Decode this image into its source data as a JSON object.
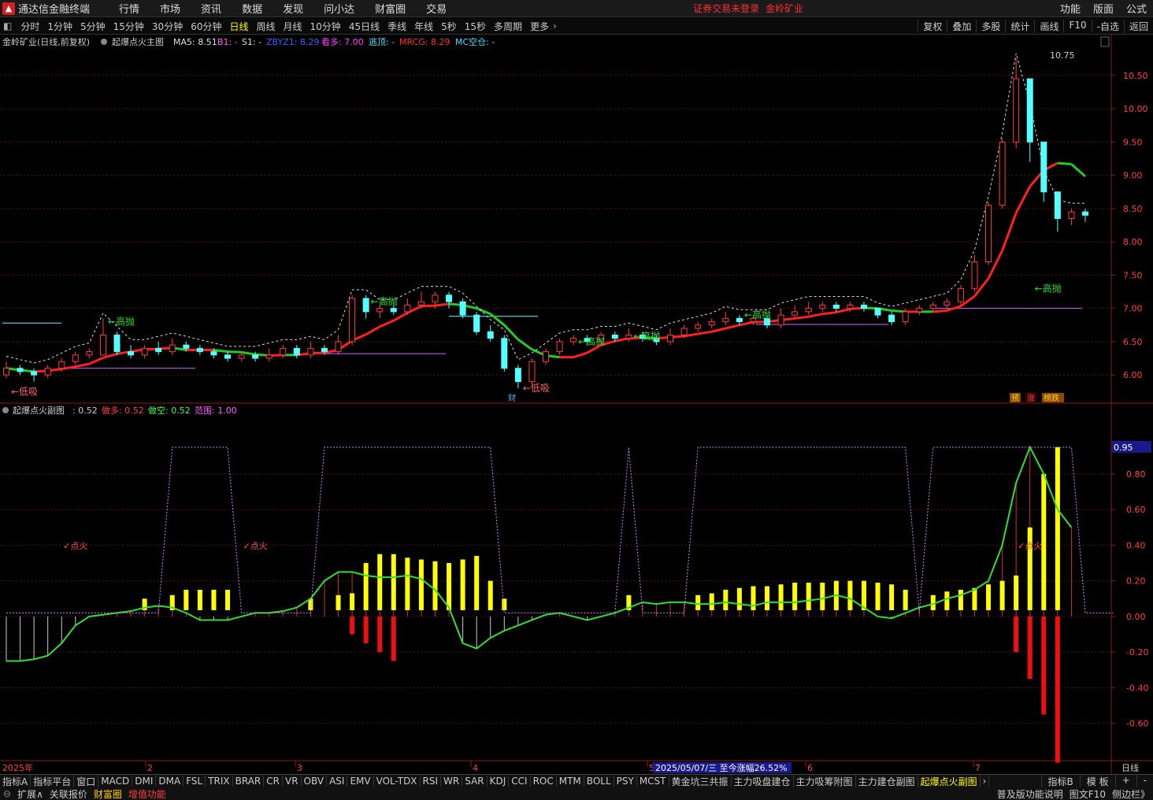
{
  "app": {
    "name": "通达信金融终端",
    "warning": "证券交易未登录",
    "stock": "金岭矿业"
  },
  "menu": [
    "行情",
    "市场",
    "资讯",
    "数据",
    "发现",
    "问小达",
    "财富圈",
    "交易"
  ],
  "menu_right": [
    "功能",
    "版面",
    "公式"
  ],
  "periods": [
    "分时",
    "1分钟",
    "5分钟",
    "15分钟",
    "30分钟",
    "60分钟",
    "日线",
    "周线",
    "月线",
    "10分钟",
    "45日线",
    "季线",
    "年线",
    "5秒",
    "15秒",
    "多周期",
    "更多"
  ],
  "active_period": "日线",
  "tools": [
    "复权",
    "叠加",
    "多股",
    "统计",
    "画线",
    "F10",
    "-自选",
    "返回"
  ],
  "main_info": {
    "title": "金岭矿业(日线,前复权)",
    "indicator": "起爆点火主图",
    "ma5": "MA5: 8.51",
    "b1": "B1: -",
    "s1": "S1: -",
    "zbyz": "ZBYZ1: 8.29",
    "kanduo": "看多: 7.00",
    "taoding": "逃顶: -",
    "mrcg": "MRCG: 8.29",
    "mckong": "MC空仓: -"
  },
  "sub_info": {
    "name": "起爆点火副图",
    "v1": ": 0.52",
    "zuoduo": "做多: 0.52",
    "zuokong": "做空: 0.52",
    "fanwei": "范围: 1.00"
  },
  "colors": {
    "bg": "#000000",
    "up": "#ff3c3c",
    "down": "#54ffff",
    "green": "#33cc33",
    "yellow": "#ffff00",
    "magenta": "#cc66ff"
  },
  "chart_data": [
    {
      "type": "candlestick",
      "title": "金岭矿业(日线,前复权)",
      "y_ticks": [
        10.5,
        10.0,
        9.5,
        9.0,
        8.5,
        8.0,
        7.5,
        7.0,
        6.5,
        6.0
      ],
      "ylim": [
        5.6,
        10.9
      ],
      "annotations": [
        {
          "text": "高抛",
          "at": 7,
          "price": 6.8
        },
        {
          "text": "高抛",
          "at": 26,
          "price": 7.1
        },
        {
          "text": "高抛",
          "at": 41,
          "price": 6.5
        },
        {
          "text": "高抛",
          "at": 45,
          "price": 6.58
        },
        {
          "text": "高抛",
          "at": 53,
          "price": 6.9
        },
        {
          "text": "高抛",
          "at": 74,
          "price": 7.3
        },
        {
          "text": "低吸",
          "at": 37,
          "price": 5.8
        },
        {
          "text": "低吸",
          "at": 0,
          "price": 5.75
        }
      ],
      "high_label": "10.75",
      "bottom_tags": [
        "财"
      ],
      "badges": [
        "预",
        "涨",
        "榜跌"
      ],
      "candles": [
        {
          "o": 6.0,
          "c": 6.1,
          "h": 6.2,
          "l": 5.95
        },
        {
          "o": 6.1,
          "c": 6.05,
          "h": 6.15,
          "l": 6.0
        },
        {
          "o": 6.05,
          "c": 6.0,
          "h": 6.1,
          "l": 5.9
        },
        {
          "o": 6.0,
          "c": 6.1,
          "h": 6.15,
          "l": 5.95
        },
        {
          "o": 6.1,
          "c": 6.2,
          "h": 6.25,
          "l": 6.05
        },
        {
          "o": 6.2,
          "c": 6.3,
          "h": 6.35,
          "l": 6.15
        },
        {
          "o": 6.3,
          "c": 6.35,
          "h": 6.4,
          "l": 6.25
        },
        {
          "o": 6.3,
          "c": 6.6,
          "h": 6.85,
          "l": 6.3
        },
        {
          "o": 6.6,
          "c": 6.35,
          "h": 6.65,
          "l": 6.3
        },
        {
          "o": 6.35,
          "c": 6.3,
          "h": 6.45,
          "l": 6.25
        },
        {
          "o": 6.3,
          "c": 6.4,
          "h": 6.45,
          "l": 6.25
        },
        {
          "o": 6.4,
          "c": 6.35,
          "h": 6.5,
          "l": 6.3
        },
        {
          "o": 6.35,
          "c": 6.45,
          "h": 6.55,
          "l": 6.3
        },
        {
          "o": 6.45,
          "c": 6.4,
          "h": 6.5,
          "l": 6.35
        },
        {
          "o": 6.4,
          "c": 6.35,
          "h": 6.45,
          "l": 6.3
        },
        {
          "o": 6.35,
          "c": 6.3,
          "h": 6.4,
          "l": 6.25
        },
        {
          "o": 6.3,
          "c": 6.25,
          "h": 6.35,
          "l": 6.2
        },
        {
          "o": 6.25,
          "c": 6.3,
          "h": 6.35,
          "l": 6.2
        },
        {
          "o": 6.3,
          "c": 6.25,
          "h": 6.35,
          "l": 6.2
        },
        {
          "o": 6.25,
          "c": 6.3,
          "h": 6.4,
          "l": 6.2
        },
        {
          "o": 6.3,
          "c": 6.4,
          "h": 6.45,
          "l": 6.25
        },
        {
          "o": 6.4,
          "c": 6.3,
          "h": 6.45,
          "l": 6.25
        },
        {
          "o": 6.3,
          "c": 6.4,
          "h": 6.5,
          "l": 6.25
        },
        {
          "o": 6.4,
          "c": 6.35,
          "h": 6.45,
          "l": 6.3
        },
        {
          "o": 6.35,
          "c": 6.5,
          "h": 6.6,
          "l": 6.3
        },
        {
          "o": 6.5,
          "c": 7.15,
          "h": 7.2,
          "l": 6.45
        },
        {
          "o": 7.15,
          "c": 6.95,
          "h": 7.2,
          "l": 6.85
        },
        {
          "o": 6.95,
          "c": 7.0,
          "h": 7.05,
          "l": 6.85
        },
        {
          "o": 7.0,
          "c": 6.95,
          "h": 7.05,
          "l": 6.9
        },
        {
          "o": 6.95,
          "c": 7.05,
          "h": 7.15,
          "l": 6.9
        },
        {
          "o": 7.05,
          "c": 7.1,
          "h": 7.25,
          "l": 7.0
        },
        {
          "o": 7.1,
          "c": 7.2,
          "h": 7.25,
          "l": 7.0
        },
        {
          "o": 7.2,
          "c": 7.1,
          "h": 7.25,
          "l": 7.0
        },
        {
          "o": 7.1,
          "c": 6.9,
          "h": 7.15,
          "l": 6.85
        },
        {
          "o": 6.9,
          "c": 6.65,
          "h": 6.95,
          "l": 6.6
        },
        {
          "o": 6.65,
          "c": 6.55,
          "h": 6.75,
          "l": 6.5
        },
        {
          "o": 6.55,
          "c": 6.1,
          "h": 6.6,
          "l": 6.05
        },
        {
          "o": 6.1,
          "c": 5.9,
          "h": 6.15,
          "l": 5.8
        },
        {
          "o": 5.9,
          "c": 6.2,
          "h": 6.25,
          "l": 5.85
        },
        {
          "o": 6.2,
          "c": 6.35,
          "h": 6.4,
          "l": 6.15
        },
        {
          "o": 6.35,
          "c": 6.5,
          "h": 6.55,
          "l": 6.3
        },
        {
          "o": 6.5,
          "c": 6.55,
          "h": 6.6,
          "l": 6.45
        },
        {
          "o": 6.55,
          "c": 6.5,
          "h": 6.6,
          "l": 6.45
        },
        {
          "o": 6.5,
          "c": 6.6,
          "h": 6.65,
          "l": 6.45
        },
        {
          "o": 6.6,
          "c": 6.55,
          "h": 6.65,
          "l": 6.5
        },
        {
          "o": 6.55,
          "c": 6.6,
          "h": 6.7,
          "l": 6.5
        },
        {
          "o": 6.6,
          "c": 6.55,
          "h": 6.65,
          "l": 6.5
        },
        {
          "o": 6.55,
          "c": 6.5,
          "h": 6.6,
          "l": 6.45
        },
        {
          "o": 6.5,
          "c": 6.6,
          "h": 6.7,
          "l": 6.45
        },
        {
          "o": 6.6,
          "c": 6.7,
          "h": 6.75,
          "l": 6.55
        },
        {
          "o": 6.7,
          "c": 6.75,
          "h": 6.8,
          "l": 6.65
        },
        {
          "o": 6.75,
          "c": 6.8,
          "h": 6.85,
          "l": 6.7
        },
        {
          "o": 6.8,
          "c": 6.85,
          "h": 6.95,
          "l": 6.75
        },
        {
          "o": 6.85,
          "c": 6.8,
          "h": 6.9,
          "l": 6.75
        },
        {
          "o": 6.8,
          "c": 6.85,
          "h": 6.9,
          "l": 6.75
        },
        {
          "o": 6.85,
          "c": 6.75,
          "h": 6.9,
          "l": 6.7
        },
        {
          "o": 6.75,
          "c": 6.9,
          "h": 7.0,
          "l": 6.7
        },
        {
          "o": 6.9,
          "c": 6.95,
          "h": 7.05,
          "l": 6.85
        },
        {
          "o": 6.95,
          "c": 7.0,
          "h": 7.1,
          "l": 6.9
        },
        {
          "o": 7.0,
          "c": 7.05,
          "h": 7.1,
          "l": 6.95
        },
        {
          "o": 7.05,
          "c": 7.0,
          "h": 7.1,
          "l": 6.95
        },
        {
          "o": 7.0,
          "c": 7.05,
          "h": 7.1,
          "l": 6.95
        },
        {
          "o": 7.05,
          "c": 7.0,
          "h": 7.1,
          "l": 6.95
        },
        {
          "o": 7.0,
          "c": 6.9,
          "h": 7.0,
          "l": 6.85
        },
        {
          "o": 6.9,
          "c": 6.8,
          "h": 6.95,
          "l": 6.75
        },
        {
          "o": 6.8,
          "c": 6.95,
          "h": 7.0,
          "l": 6.75
        },
        {
          "o": 6.95,
          "c": 7.0,
          "h": 7.05,
          "l": 6.9
        },
        {
          "o": 7.0,
          "c": 7.05,
          "h": 7.1,
          "l": 6.95
        },
        {
          "o": 7.05,
          "c": 7.1,
          "h": 7.15,
          "l": 7.0
        },
        {
          "o": 7.1,
          "c": 7.3,
          "h": 7.35,
          "l": 7.05
        },
        {
          "o": 7.3,
          "c": 7.7,
          "h": 7.8,
          "l": 7.25
        },
        {
          "o": 7.7,
          "c": 8.55,
          "h": 8.6,
          "l": 7.65
        },
        {
          "o": 8.55,
          "c": 9.5,
          "h": 9.55,
          "l": 8.5
        },
        {
          "o": 9.5,
          "c": 10.45,
          "h": 10.75,
          "l": 9.4
        },
        {
          "o": 10.45,
          "c": 9.5,
          "h": 10.0,
          "l": 9.2
        },
        {
          "o": 9.5,
          "c": 8.75,
          "h": 9.0,
          "l": 8.6
        },
        {
          "o": 8.75,
          "c": 8.35,
          "h": 8.55,
          "l": 8.15
        },
        {
          "o": 8.35,
          "c": 8.45,
          "h": 8.5,
          "l": 8.25
        },
        {
          "o": 8.45,
          "c": 8.4,
          "h": 8.5,
          "l": 8.3
        }
      ]
    },
    {
      "type": "bar",
      "title": "起爆点火副图",
      "y_ticks": [
        0.95,
        0.8,
        0.6,
        0.4,
        0.2,
        0.0,
        -0.2,
        -0.4,
        -0.6
      ],
      "current_value_label": "0.95",
      "ylim": [
        -0.8,
        1.1
      ],
      "annotations": [
        "点火",
        "点火",
        "点火"
      ],
      "yellow_bars": [
        0,
        0,
        0,
        0,
        0,
        0,
        0,
        0,
        0,
        0,
        0.1,
        0,
        0.12,
        0.15,
        0.15,
        0.15,
        0.15,
        0,
        0,
        0,
        0,
        0,
        0.1,
        0,
        0.12,
        0.13,
        0.3,
        0.35,
        0.35,
        0.33,
        0.32,
        0.31,
        0.3,
        0.32,
        0.34,
        0.2,
        0.1,
        0,
        0,
        0,
        0,
        0,
        0,
        0,
        0,
        0.12,
        0,
        0,
        0,
        0,
        0.12,
        0.13,
        0.15,
        0.16,
        0.17,
        0.17,
        0.18,
        0.19,
        0.19,
        0.19,
        0.2,
        0.2,
        0.2,
        0.19,
        0.18,
        0.15,
        0,
        0.12,
        0.14,
        0.15,
        0.16,
        0.18,
        0.2,
        0.23,
        0.5,
        0.8,
        0.95,
        0.0,
        0.0,
        0.0,
        0.0
      ],
      "red_bars": [
        0,
        0,
        0,
        0,
        0,
        0,
        0,
        0,
        0,
        0,
        0,
        0,
        0,
        0,
        0,
        0,
        0,
        0,
        0,
        0,
        0,
        0,
        0,
        0,
        0,
        -0.1,
        -0.15,
        -0.2,
        -0.25,
        0,
        0,
        0,
        0,
        0,
        0,
        0,
        0,
        0,
        0,
        0,
        0,
        0,
        0,
        0,
        0,
        0,
        0,
        0,
        0,
        0,
        0,
        0,
        0,
        0,
        0,
        0,
        0,
        0,
        0,
        0,
        0,
        0,
        0,
        0,
        0,
        0,
        0,
        0,
        0,
        0,
        0,
        0,
        0,
        -0.2,
        -0.35,
        -0.55,
        -0.82,
        0,
        0,
        0,
        0
      ],
      "line": [
        -0.25,
        -0.25,
        -0.24,
        -0.22,
        -0.15,
        -0.05,
        0.0,
        0.01,
        0.02,
        0.03,
        0.05,
        0.06,
        0.05,
        0.02,
        -0.02,
        -0.02,
        -0.02,
        0.0,
        0.02,
        0.02,
        0.03,
        0.05,
        0.1,
        0.2,
        0.25,
        0.25,
        0.23,
        0.22,
        0.22,
        0.23,
        0.21,
        0.15,
        0.05,
        -0.15,
        -0.18,
        -0.12,
        -0.08,
        -0.05,
        -0.02,
        0.01,
        0.02,
        0.0,
        -0.02,
        0.0,
        0.02,
        0.05,
        0.08,
        0.07,
        0.08,
        0.08,
        0.07,
        0.07,
        0.08,
        0.07,
        0.06,
        0.08,
        0.08,
        0.08,
        0.09,
        0.1,
        0.12,
        0.1,
        0.05,
        0.0,
        -0.01,
        0.02,
        0.05,
        0.07,
        0.1,
        0.12,
        0.15,
        0.2,
        0.4,
        0.75,
        0.95,
        0.8,
        0.6,
        0.5
      ]
    }
  ],
  "x_axis": {
    "year": "2025年",
    "months": [
      "2",
      "3",
      "4",
      "5",
      "6",
      "7"
    ],
    "tooltip": "2025/05/07/三  至今涨幅26.52%",
    "period_tag": "日线"
  },
  "indicator_tabs": [
    "指标A",
    "指标平台",
    "窗口",
    "MACD",
    "DMI",
    "DMA",
    "FSL",
    "TRIX",
    "BRAR",
    "CR",
    "VR",
    "OBV",
    "ASI",
    "EMV",
    "VOL-TDX",
    "RSI",
    "WR",
    "SAR",
    "KDJ",
    "CCI",
    "ROC",
    "MTM",
    "BOLL",
    "PSY",
    "MCST",
    "黄金坑三共振",
    "主力吸盘建仓",
    "主力吸筹附图",
    "主力建仓副图",
    "起爆点火副图"
  ],
  "active_indicator": "起爆点火副图",
  "bottom_right": [
    "指标B",
    "模 板",
    "+",
    "-"
  ],
  "status_items": [
    "扩展∧",
    "关联报价",
    "财富圈",
    "增值功能"
  ],
  "status_right": [
    "普及版功能说明",
    "图文F10",
    "侧边栏》"
  ]
}
